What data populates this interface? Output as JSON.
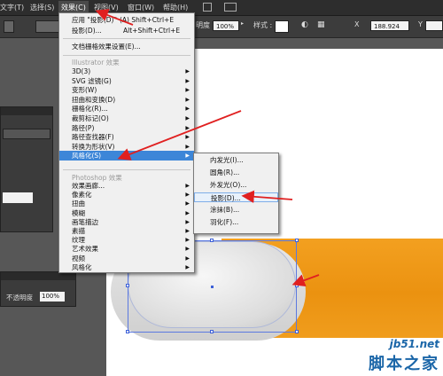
{
  "menubar": {
    "items": [
      "文字(T)",
      "选择(S)",
      "效果(C)",
      "视图(V)",
      "窗口(W)",
      "帮助(H)"
    ]
  },
  "control_bar": {
    "opacity_label": "明度",
    "opacity_value": "100%",
    "style_label": "样式 :",
    "x_value": "188.924"
  },
  "bottom_panel": {
    "opacity_label": "不透明度",
    "opacity_value": "100%"
  },
  "effect_menu": {
    "top_items": [
      {
        "label": "应用 \"投影(D)\"",
        "shortcut": "(A)   Shift+Ctrl+E"
      },
      {
        "label": "投影(D)...",
        "shortcut": "Alt+Shift+Ctrl+E"
      }
    ],
    "doc_raster": "文档栅格效果设置(E)...",
    "illustrator_header": "Illustrator 效果",
    "illustrator_items": [
      "3D(3)",
      "SVG 滤镜(G)",
      "变形(W)",
      "扭曲和变换(D)",
      "栅格化(R)...",
      "裁剪标记(O)",
      "路径(P)",
      "路径查找器(F)",
      "转换为形状(V)",
      "风格化(S)"
    ],
    "photoshop_header": "Photoshop 效果",
    "photoshop_items": [
      "效果画廊...",
      "像素化",
      "扭曲",
      "模糊",
      "画笔描边",
      "素描",
      "纹理",
      "艺术效果",
      "视频",
      "风格化"
    ]
  },
  "stylize_submenu": {
    "items": [
      "内发光(I)...",
      "圆角(R)...",
      "外发光(O)...",
      "投影(D)...",
      "涂抹(B)...",
      "羽化(F)..."
    ]
  },
  "watermark": {
    "line1": "jb51.net",
    "line2": "脚本之家"
  },
  "colors": {
    "menu_highlight": "#3d86d8",
    "arrow": "#e02020",
    "orange": "#f09a1a",
    "selection": "#3d60d8"
  }
}
